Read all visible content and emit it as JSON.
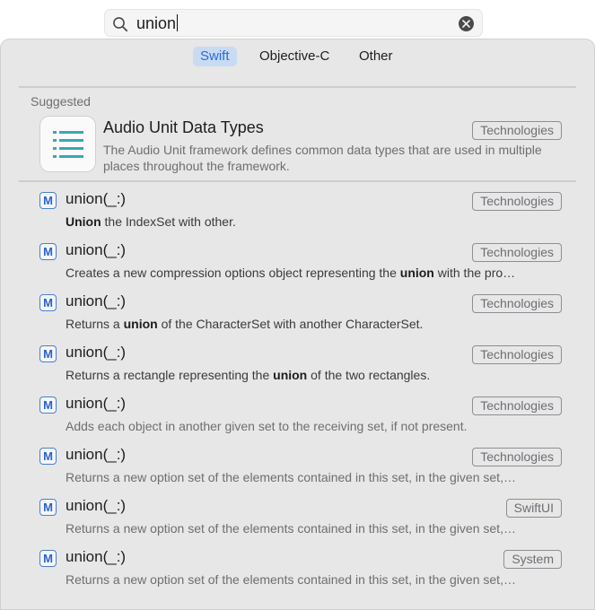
{
  "search": {
    "query": "union"
  },
  "language_tabs": [
    {
      "label": "Swift",
      "active": true
    },
    {
      "label": "Objective-C",
      "active": false
    },
    {
      "label": "Other",
      "active": false
    }
  ],
  "suggested": {
    "section_label": "Suggested",
    "icon": "list-icon",
    "title": "Audio Unit Data Types",
    "badge": "Technologies",
    "description": "The Audio Unit framework defines common data types that are used in multiple places throughout the framework."
  },
  "results": [
    {
      "icon_letter": "M",
      "title": "union(_:)",
      "badge": "Technologies",
      "desc_before": "",
      "desc_bold": "Union",
      "desc_after": " the IndexSet with other.",
      "muted": false
    },
    {
      "icon_letter": "M",
      "title": "union(_:)",
      "badge": "Technologies",
      "desc_before": "Creates a new compression options object representing the ",
      "desc_bold": "union",
      "desc_after": " with the pro…",
      "muted": false
    },
    {
      "icon_letter": "M",
      "title": "union(_:)",
      "badge": "Technologies",
      "desc_before": "Returns a ",
      "desc_bold": "union",
      "desc_after": " of the CharacterSet with another CharacterSet.",
      "muted": false
    },
    {
      "icon_letter": "M",
      "title": "union(_:)",
      "badge": "Technologies",
      "desc_before": "Returns a rectangle representing the ",
      "desc_bold": "union",
      "desc_after": " of the two rectangles.",
      "muted": false
    },
    {
      "icon_letter": "M",
      "title": "union(_:)",
      "badge": "Technologies",
      "desc_before": "Adds each object in another given set to the receiving set, if not present.",
      "desc_bold": "",
      "desc_after": "",
      "muted": true
    },
    {
      "icon_letter": "M",
      "title": "union(_:)",
      "badge": "Technologies",
      "desc_before": "Returns a new option set of the elements contained in this set, in the given set,…",
      "desc_bold": "",
      "desc_after": "",
      "muted": true
    },
    {
      "icon_letter": "M",
      "title": "union(_:)",
      "badge": "SwiftUI",
      "desc_before": "Returns a new option set of the elements contained in this set, in the given set,…",
      "desc_bold": "",
      "desc_after": "",
      "muted": true
    },
    {
      "icon_letter": "M",
      "title": "union(_:)",
      "badge": "System",
      "desc_before": "Returns a new option set of the elements contained in this set, in the given set,…",
      "desc_bold": "",
      "desc_after": "",
      "muted": true
    }
  ],
  "colors": {
    "accent": "#2a6ad8",
    "tab_active_bg": "#c9dbf2",
    "panel_bg": "#e7e7e7",
    "icon_teal": "#3aa6b9"
  }
}
